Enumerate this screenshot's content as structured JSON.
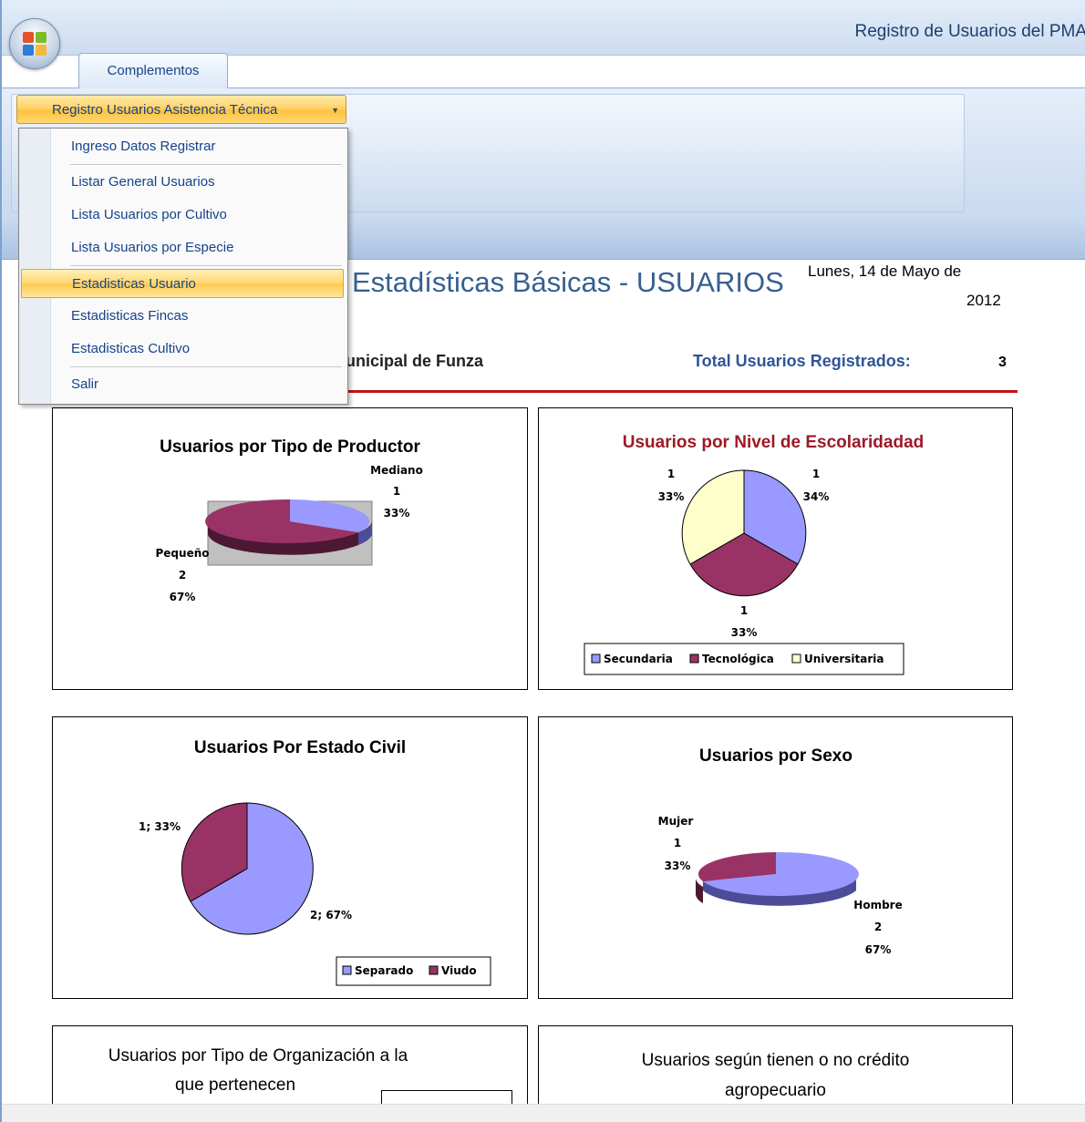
{
  "window": {
    "app_title": "Registro de Usuarios del PMA",
    "tab_label": "Complementos",
    "dropdown_label": "Registro Usuarios Asistencia Técnica"
  },
  "menu": {
    "items": [
      {
        "label": "Ingreso Datos Registrar"
      },
      {
        "label": "Listar General Usuarios"
      },
      {
        "label": "Lista Usuarios por Cultivo"
      },
      {
        "label": "Lista Usuarios por Especie"
      },
      {
        "label": "Estadisticas Usuario"
      },
      {
        "label": "Estadisticas Fincas"
      },
      {
        "label": "Estadisticas Cultivo"
      },
      {
        "label": "Salir"
      }
    ]
  },
  "report": {
    "title": "Estadísticas Básicas - USUARIOS",
    "date_line1": "Lunes, 14 de Mayo de",
    "date_line2": "2012",
    "municipio": "Iunicipal de Funza",
    "total_label": "Total Usuarios Registrados:",
    "total_value": "3"
  },
  "colors": {
    "slice_blue": "#9999ff",
    "slice_maroon": "#993366",
    "slice_cream": "#ffffcc",
    "title_red": "#9c1a26",
    "accent_blue": "#365f91"
  },
  "chart_data": [
    {
      "type": "pie",
      "title": "Usuarios por Tipo de Productor",
      "categories": [
        "Mediano",
        "Pequeño"
      ],
      "values": [
        1,
        2
      ],
      "labels": [
        {
          "name": "Mediano",
          "value": "1",
          "percent": "33%"
        },
        {
          "name": "Pequeño",
          "value": "2",
          "percent": "67%"
        }
      ]
    },
    {
      "type": "pie",
      "title": "Usuarios por Nivel de Escolaridadad",
      "categories": [
        "Secundaria",
        "Tecnológica",
        "Universitaria"
      ],
      "values": [
        1,
        1,
        1
      ],
      "labels": [
        {
          "value": "1",
          "percent": "34%"
        },
        {
          "value": "1",
          "percent": "33%"
        },
        {
          "value": "1",
          "percent": "33%"
        }
      ],
      "legend": [
        "Secundaria",
        "Tecnológica",
        "Universitaria"
      ],
      "legend_position": "bottom"
    },
    {
      "type": "pie",
      "title": "Usuarios Por Estado Civil",
      "categories": [
        "Separado",
        "Viudo"
      ],
      "values": [
        2,
        1
      ],
      "labels": [
        "2; 67%",
        "1; 33%"
      ],
      "legend": [
        "Separado",
        "Viudo"
      ],
      "legend_position": "bottom-right"
    },
    {
      "type": "pie",
      "title": "Usuarios por Sexo",
      "categories": [
        "Hombre",
        "Mujer"
      ],
      "values": [
        2,
        1
      ],
      "labels": [
        {
          "name": "Hombre",
          "value": "2",
          "percent": "67%"
        },
        {
          "name": "Mujer",
          "value": "1",
          "percent": "33%"
        }
      ]
    },
    {
      "type": "pie",
      "title": "Usuarios por Tipo de Organización a la que pertenecen",
      "title_lines": [
        "Usuarios por Tipo de Organización a la",
        "que pertenecen"
      ]
    },
    {
      "type": "pie",
      "title": "Usuarios según tienen o no crédito agropecuario",
      "title_lines": [
        "Usuarios según tienen o no crédito",
        "agropecuario"
      ]
    }
  ]
}
